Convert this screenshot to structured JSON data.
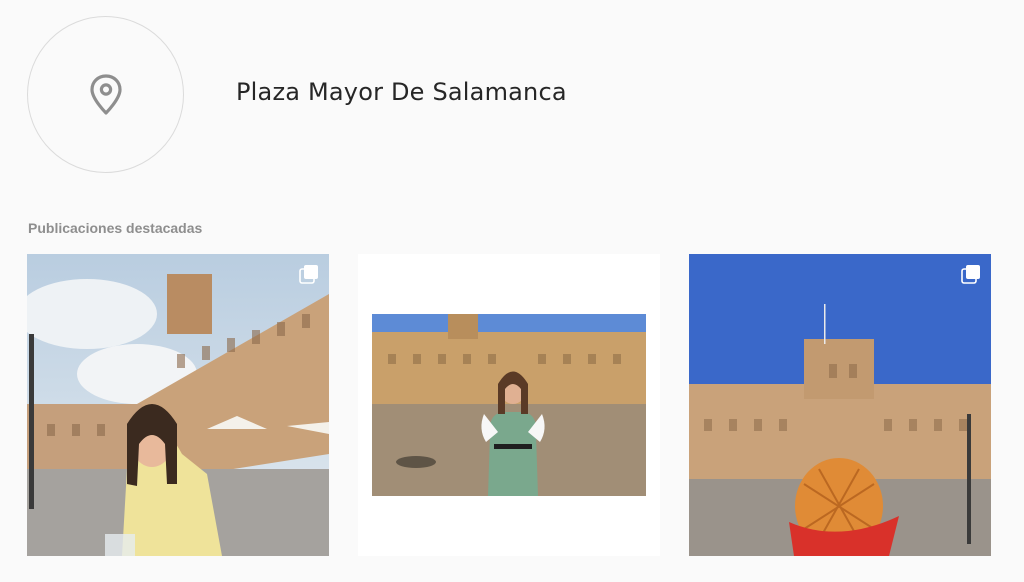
{
  "location": {
    "name": "Plaza Mayor De Salamanca",
    "icon": "location-pin-icon"
  },
  "featured": {
    "label": "Publicaciones destacadas",
    "posts": [
      {
        "alt": "",
        "multiple": true
      },
      {
        "alt": "",
        "multiple": false
      },
      {
        "alt": "",
        "multiple": true
      }
    ]
  },
  "colors": {
    "background": "#fafafa",
    "border": "#dbdbdb",
    "muted_text": "#8e8e8e",
    "primary_text": "#262626"
  }
}
